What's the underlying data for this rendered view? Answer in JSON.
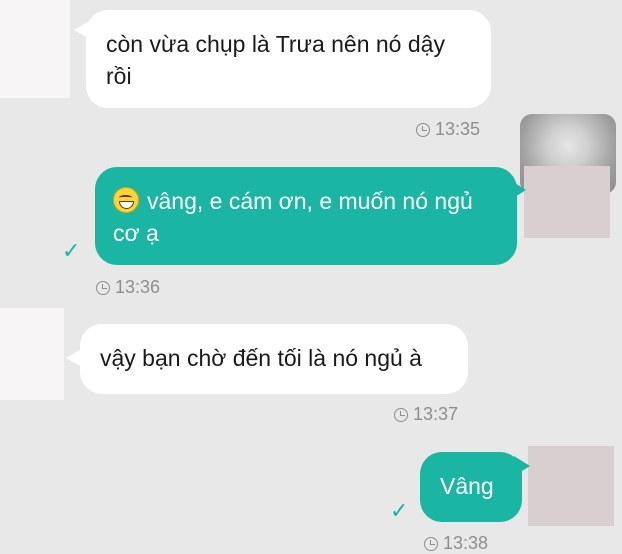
{
  "messages": [
    {
      "direction": "incoming",
      "text": "còn vừa chụp là Trưa nên nó dậy rồi",
      "time": "13:35"
    },
    {
      "direction": "outgoing",
      "emoji": "grinning-face",
      "text": "vâng, e cám ơn, e muốn nó ngủ cơ ạ",
      "time": "13:36",
      "status": "sent-check"
    },
    {
      "direction": "incoming",
      "text": "vậy bạn chờ đến tối là nó ngủ à",
      "time": "13:37"
    },
    {
      "direction": "outgoing",
      "text": "Vâng",
      "time": "13:38",
      "status": "sent-check"
    }
  ],
  "colors": {
    "background": "#e8e8e8",
    "incoming_bubble": "#ffffff",
    "outgoing_bubble": "#1bb6a3",
    "timestamp": "#8e8e8e"
  },
  "icons": {
    "time": "clock-icon",
    "sent": "check-icon"
  }
}
